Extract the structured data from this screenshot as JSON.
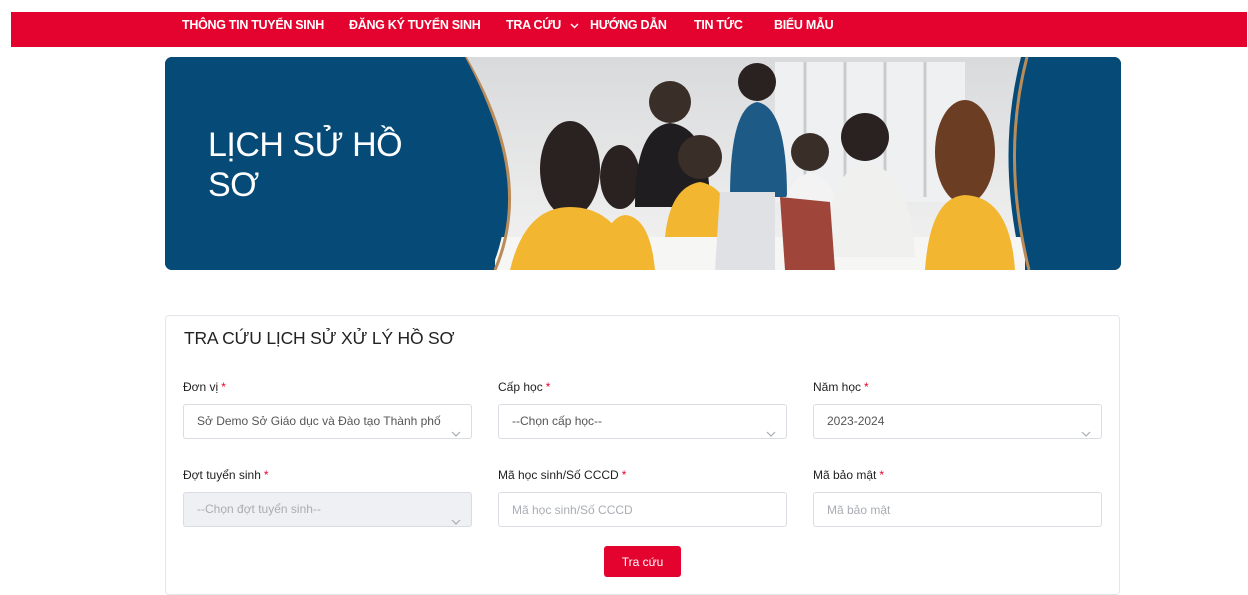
{
  "nav": {
    "items": [
      {
        "label": "THÔNG TIN TUYỂN SINH"
      },
      {
        "label": "ĐĂNG KÝ TUYỂN SINH"
      },
      {
        "label": "TRA CỨU"
      },
      {
        "label": "HƯỚNG DẪN"
      },
      {
        "label": "TIN TỨC"
      },
      {
        "label": "BIỂU MẪU"
      }
    ]
  },
  "banner": {
    "title_line1": "LỊCH SỬ HỒ",
    "title_line2": "SƠ"
  },
  "form": {
    "title": "TRA CỨU LỊCH SỬ XỬ LÝ HỒ SƠ",
    "required_mark": "*",
    "don_vi": {
      "label": "Đơn vị",
      "value": "Sở Demo Sở Giáo dục và Đào tạo Thành phố Đ"
    },
    "cap_hoc": {
      "label": "Cấp học",
      "value": "--Chọn cấp học--"
    },
    "nam_hoc": {
      "label": "Năm học",
      "value": "2023-2024"
    },
    "dot_tuyen_sinh": {
      "label": "Đợt tuyển sinh",
      "value": "--Chọn đợt tuyển sinh--"
    },
    "ma_hoc_sinh": {
      "label": "Mã học sinh/Số CCCD",
      "placeholder": "Mã học sinh/Số CCCD"
    },
    "ma_bao_mat": {
      "label": "Mã bảo mật",
      "placeholder": "Mã bảo mật"
    },
    "submit_label": "Tra cứu"
  },
  "colors": {
    "brand_red": "#e4032e",
    "banner_navy": "#064a78",
    "banner_accent": "#b98c5a"
  }
}
